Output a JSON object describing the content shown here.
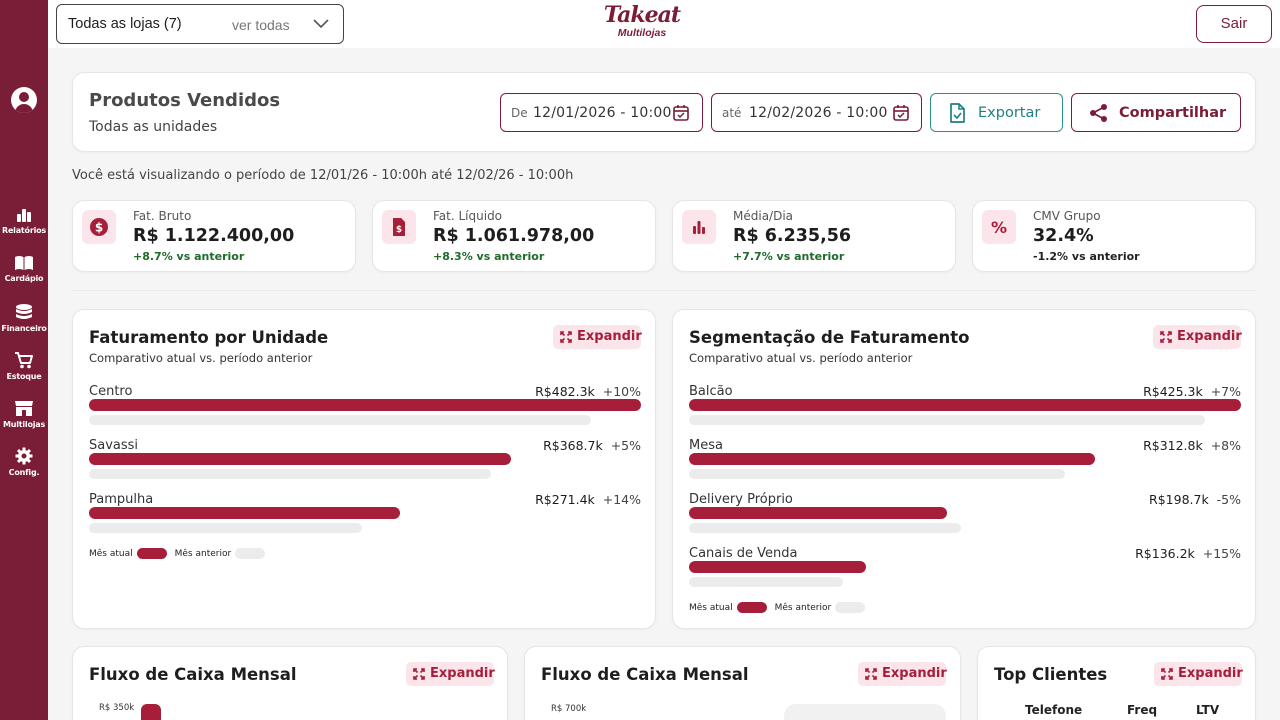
{
  "sidebar": {
    "items": [
      {
        "label": "Relatórios",
        "icon": "bar-chart-icon"
      },
      {
        "label": "Cardápio",
        "icon": "book-icon"
      },
      {
        "label": "Financeiro",
        "icon": "coins-icon"
      },
      {
        "label": "Estoque",
        "icon": "cart-icon"
      },
      {
        "label": "Multilojas",
        "icon": "store-icon"
      },
      {
        "label": "Config.",
        "icon": "gear-icon"
      }
    ]
  },
  "topbar": {
    "store_selector": {
      "value": "Todas as lojas (7)",
      "link": "ver todas"
    },
    "logo": {
      "word": "Takeat",
      "sub": "Multilojas"
    },
    "logout_label": "Sair"
  },
  "header": {
    "title": "Produtos Vendidos",
    "subtitle": "Todas as unidades",
    "date_from_prefix": "De",
    "date_from": "12/01/2026 - 10:00",
    "date_to_prefix": "até",
    "date_to": "12/02/2026 - 10:00",
    "export_label": "Exportar",
    "share_label": "Compartilhar"
  },
  "period_text": "Você está visualizando o período de 12/01/26 - 10:00h até 12/02/26 - 10:00h",
  "kpis": [
    {
      "label": "Fat. Bruto",
      "value": "R$ 1.122.400,00",
      "delta": "+8.7% vs anterior",
      "icon": "dollar-icon",
      "color": "#1e6b2a"
    },
    {
      "label": "Fat. Líquido",
      "value": "R$ 1.061.978,00",
      "delta": "+8.3% vs anterior",
      "icon": "document-dollar-icon",
      "color": "#1e6b2a"
    },
    {
      "label": "Média/Dia",
      "value": "R$ 6.235,56",
      "delta": "+7.7% vs anterior",
      "icon": "bar-chart-icon",
      "color": "#1e6b2a"
    },
    {
      "label": "CMV Grupo",
      "value": "32.4%",
      "delta": "-1.2% vs anterior",
      "icon": "percent-icon",
      "color": "#222222"
    }
  ],
  "expand_label": "Expandir",
  "charts": {
    "unidade": {
      "title": "Faturamento por Unidade",
      "subtitle": "Comparativo atual vs. período anterior",
      "legend_current": "Mês atual",
      "legend_previous": "Mês anterior",
      "rows": [
        {
          "name": "Centro",
          "amount": "R$482.3k",
          "change": "+10%"
        },
        {
          "name": "Savassi",
          "amount": "R$368.7k",
          "change": "+5%"
        },
        {
          "name": "Pampulha",
          "amount": "R$271.4k",
          "change": "+14%"
        }
      ]
    },
    "segmentacao": {
      "title": "Segmentação de Faturamento",
      "subtitle": "Comparativo atual vs. período anterior",
      "legend_current": "Mês atual",
      "legend_previous": "Mês anterior",
      "rows": [
        {
          "name": "Balcão",
          "amount": "R$425.3k",
          "change": "+7%"
        },
        {
          "name": "Mesa",
          "amount": "R$312.8k",
          "change": "+8%"
        },
        {
          "name": "Delivery Próprio",
          "amount": "R$198.7k",
          "change": "-5%"
        },
        {
          "name": "Canais de Venda",
          "amount": "R$136.2k",
          "change": "+15%"
        }
      ]
    }
  },
  "chart_data": [
    {
      "type": "bar",
      "title": "Faturamento por Unidade",
      "categories": [
        "Centro",
        "Savassi",
        "Pampulha"
      ],
      "series": [
        {
          "name": "Mês atual",
          "values": [
            482.3,
            368.7,
            271.4
          ]
        },
        {
          "name": "Mês anterior",
          "values": [
            438.5,
            351.1,
            238.1
          ]
        }
      ],
      "unit": "R$ k"
    },
    {
      "type": "bar",
      "title": "Segmentação de Faturamento",
      "categories": [
        "Balcão",
        "Mesa",
        "Delivery Próprio",
        "Canais de Venda"
      ],
      "series": [
        {
          "name": "Mês atual",
          "values": [
            425.3,
            312.8,
            198.7,
            136.2
          ]
        },
        {
          "name": "Mês anterior",
          "values": [
            397.5,
            289.6,
            209.2,
            118.4
          ]
        }
      ],
      "unit": "R$ k"
    }
  ],
  "bottom": {
    "fluxo1": {
      "title": "Fluxo de Caixa Mensal",
      "ytick": "R$ 350k"
    },
    "fluxo2": {
      "title": "Fluxo de Caixa Mensal",
      "ytick": "R$ 700k"
    },
    "top_clientes": {
      "title": "Top Clientes",
      "columns": [
        "Telefone",
        "Freq",
        "LTV"
      ]
    }
  },
  "colors": {
    "brand": "#7a1d36",
    "accent": "#a61e3a",
    "teal": "#1f7f84",
    "positive": "#1e6b2a"
  }
}
